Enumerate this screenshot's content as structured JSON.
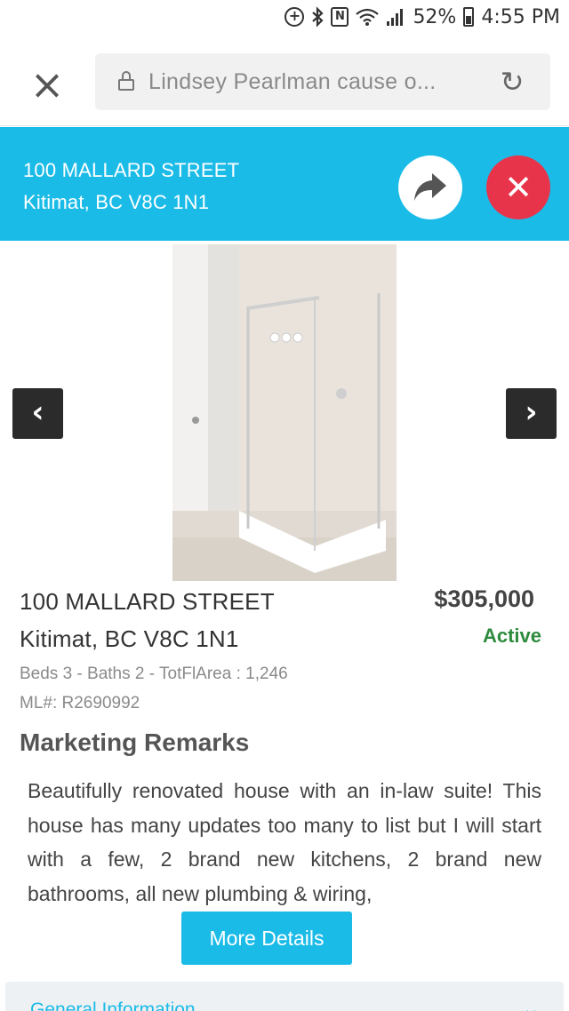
{
  "status_bar": {
    "battery": "52%",
    "time": "4:55 PM",
    "icons": [
      "data-saver-icon",
      "bluetooth-icon",
      "nfc-icon",
      "wifi-icon",
      "signal-icon",
      "battery-icon"
    ]
  },
  "browser": {
    "url_text": "Lindsey Pearlman cause o...",
    "close_icon": "close-icon",
    "lock_icon": "lock-icon",
    "reload_icon": "reload-icon"
  },
  "banner": {
    "address_line1": "100 MALLARD STREET",
    "address_line2": "Kitimat, BC V8C 1N1",
    "share_icon": "share-icon",
    "cancel_icon": "close-circle-icon",
    "background_color": "#1bbbe8",
    "cancel_color": "#e8344a"
  },
  "carousel": {
    "prev_icon": "chevron-left-icon",
    "next_icon": "chevron-right-icon"
  },
  "listing": {
    "address_line1": "100 MALLARD STREET",
    "address_line2": "Kitimat, BC V8C 1N1",
    "price": "$305,000",
    "status": "Active",
    "status_color": "#2e8b3e",
    "details": "Beds 3 - Baths 2 - TotFlArea : 1,246",
    "mls": "ML#: R2690992"
  },
  "remarks": {
    "title": "Marketing Remarks",
    "text": "Beautifully renovated house with an in-law suite! This house has many updates too many to list but I will start with a few, 2 brand new kitchens, 2 brand new bathrooms, all new plumbing & wiring,",
    "more_label": "More Details"
  },
  "accordion": {
    "label": "General Information"
  }
}
